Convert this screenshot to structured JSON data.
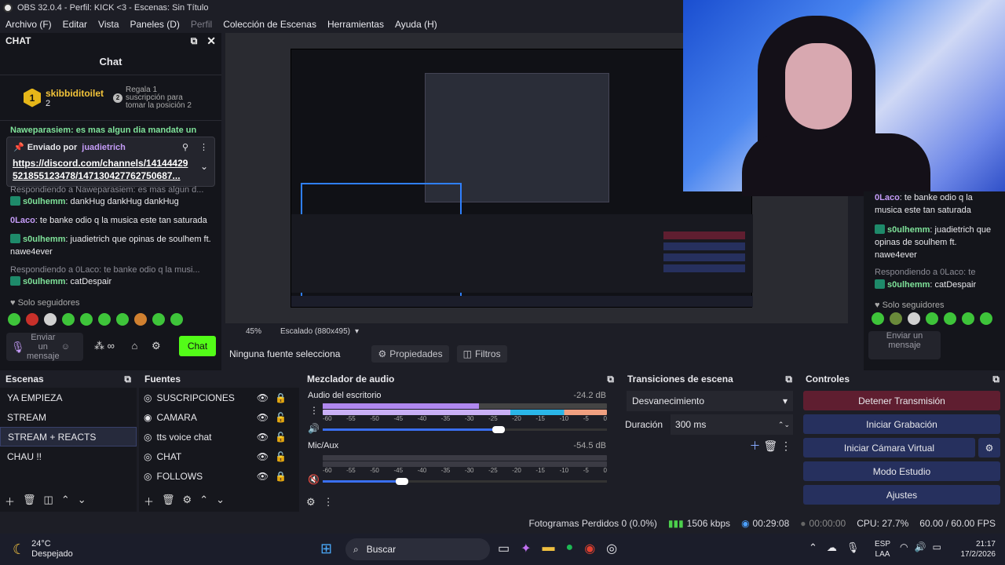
{
  "window": {
    "title": "OBS 32.0.4 - Perfil: KICK <3 - Escenas: Sin Título"
  },
  "menu": [
    "Archivo (F)",
    "Editar",
    "Vista",
    "Paneles (D)",
    "Perfil",
    "Colección de Escenas",
    "Herramientas",
    "Ayuda (H)"
  ],
  "chat": {
    "dock_title": "CHAT",
    "title": "Chat",
    "leader_name": "skibbiditoilet",
    "leader_rank": "1",
    "leader_count": "2",
    "gift_rank": "2",
    "gift_text_1": "Regala 1",
    "gift_text_2": "suscripción para",
    "gift_text_3": "tomar la posición 2",
    "partial_top": "Naweparasiem: es mas algun dia mandate un",
    "pinned_by_label": "Enviado por",
    "pinned_by": "juadietrich",
    "pinned_link_1": "https://discord.com/channels/14144429",
    "pinned_link_2": "521855123478/147130427762750687...",
    "reply1": "Respondiendo a Naweparasiem: es mas algun d...",
    "m1_user": "s0ulhemm",
    "m1_text": ": dankHug dankHug dankHug",
    "m2_user": "0Laco",
    "m2_text": ": te banke odio q la musica este tan saturada",
    "m3_user": "s0ulhemm",
    "m3_text": ": juadietrich que opinas de soulhem ft.",
    "m3_text2": "nawe4ever",
    "reply2": "Respondiendo a 0Laco: te banke odio q la musi...",
    "m4_user": "s0ulhemm",
    "m4_text": ": catDespair",
    "followers": "Solo seguidores",
    "input_placeholder": "Enviar un mensaje",
    "send_label": "Chat"
  },
  "right_chat": {
    "r1_user": "0Laco",
    "r1_text": ": te banke odio q la",
    "r1_text2": "musica este tan saturada",
    "r2_user": "s0ulhemm",
    "r2_text": ": juadietrich que",
    "r2_text2": "opinas de soulhem ft.",
    "r2_text3": "nawe4ever",
    "r3": "Respondiendo a 0Laco: te",
    "r4_user": "s0ulhemm",
    "r4_text": ": catDespair",
    "followers": "Solo seguidores",
    "input": "Enviar un mensaje"
  },
  "zoom": {
    "percent": "45%",
    "scale": "Escalado (880x495)"
  },
  "source_bar": {
    "none": "Ninguna fuente selecciona",
    "props": "Propiedades",
    "filters": "Filtros"
  },
  "scenes": {
    "title": "Escenas",
    "items": [
      "YA EMPIEZA",
      "STREAM",
      "STREAM + REACTS",
      "CHAU !!"
    ],
    "selected": 2
  },
  "sources": {
    "title": "Fuentes",
    "items": [
      "SUSCRIPCIONES",
      "CAMARA",
      "tts voice chat",
      "CHAT",
      "FOLLOWS"
    ]
  },
  "mixer": {
    "title": "Mezclador de audio",
    "ch1": {
      "name": "Audio del escritorio",
      "db": "-24.2 dB",
      "level": 0.55,
      "volume": 0.62
    },
    "ch2": {
      "name": "Mic/Aux",
      "db": "-54.5 dB",
      "level": 0.0,
      "volume": 0.28
    },
    "ticks": [
      "-60",
      "-55",
      "-50",
      "-45",
      "-40",
      "-35",
      "-30",
      "-25",
      "-20",
      "-15",
      "-10",
      "-5",
      "0"
    ]
  },
  "transitions": {
    "title": "Transiciones de escena",
    "selected": "Desvanecimiento",
    "duration_label": "Duración",
    "duration": "300 ms"
  },
  "controls": {
    "title": "Controles",
    "stop": "Detener Transmisión",
    "record": "Iniciar Grabación",
    "vcam": "Iniciar Cámara Virtual",
    "studio": "Modo Estudio",
    "settings": "Ajustes"
  },
  "status": {
    "dropped": "Fotogramas Perdidos 0 (0.0%)",
    "kbps": "1506 kbps",
    "live": "00:29:08",
    "rec": "00:00:00",
    "cpu": "CPU: 27.7%",
    "fps": "60.00 / 60.00 FPS"
  },
  "taskbar": {
    "temp": "24°C",
    "weather": "Despejado",
    "search": "Buscar",
    "lang1": "ESP",
    "lang2": "LAA",
    "time": "21:17",
    "date": "17/2/2026"
  },
  "colors": {
    "accent_green": "#53fc18",
    "stop_red": "#5f1e30",
    "control_blue": "#26305e"
  }
}
